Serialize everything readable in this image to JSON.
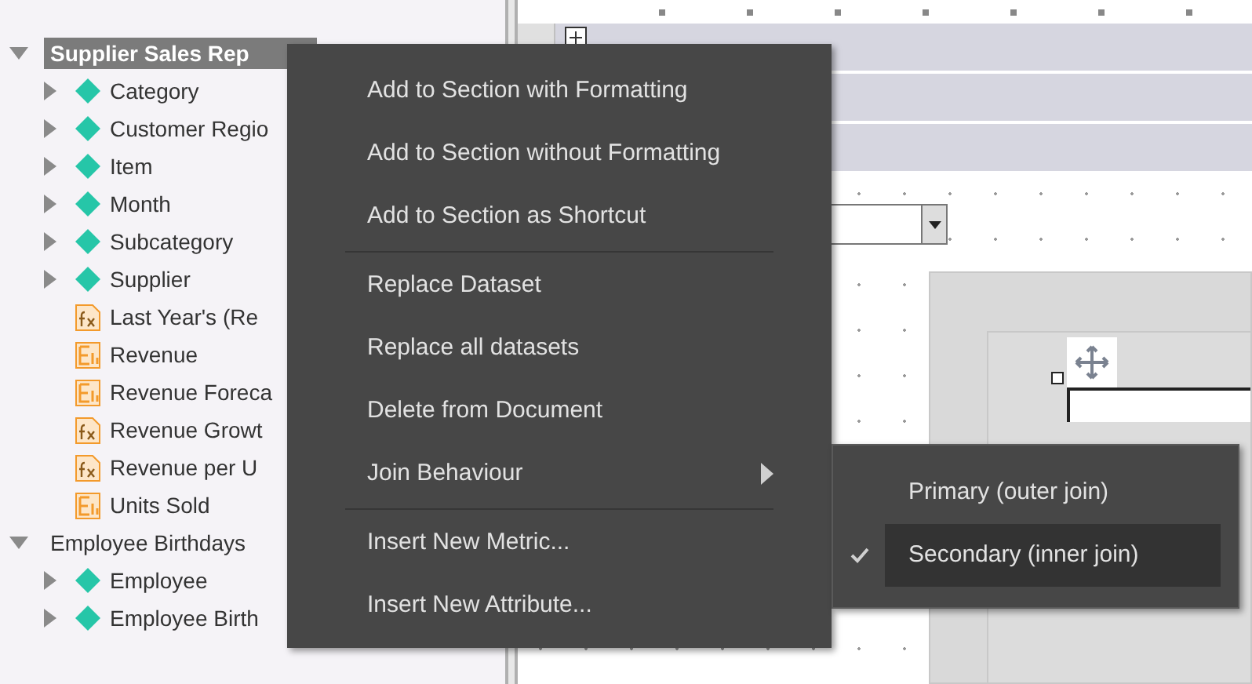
{
  "tree": [
    {
      "label": "Supplier Sales Rep",
      "selected": true,
      "expanded": true,
      "children": [
        {
          "label": "Category",
          "kind": "attribute",
          "expanded": false
        },
        {
          "label": "Customer Regio",
          "kind": "attribute",
          "expanded": false
        },
        {
          "label": "Item",
          "kind": "attribute",
          "expanded": false
        },
        {
          "label": "Month",
          "kind": "attribute",
          "expanded": false
        },
        {
          "label": "Subcategory",
          "kind": "attribute",
          "expanded": false
        },
        {
          "label": "Supplier",
          "kind": "attribute",
          "expanded": false
        },
        {
          "label": "Last Year's (Re",
          "kind": "derived"
        },
        {
          "label": "Revenue",
          "kind": "metric"
        },
        {
          "label": "Revenue Foreca",
          "kind": "metric"
        },
        {
          "label": "Revenue Growt",
          "kind": "derived"
        },
        {
          "label": "Revenue per U",
          "kind": "derived"
        },
        {
          "label": "Units Sold",
          "kind": "metric"
        }
      ]
    },
    {
      "label": "Employee Birthdays",
      "selected": false,
      "expanded": true,
      "children": [
        {
          "label": "Employee",
          "kind": "attribute",
          "expanded": false
        },
        {
          "label": "Employee Birth",
          "kind": "attribute",
          "expanded": false
        }
      ]
    }
  ],
  "context_menu": {
    "groups": [
      [
        {
          "label": "Add to Section with Formatting",
          "submenu": false
        },
        {
          "label": "Add to Section without Formatting",
          "submenu": false
        },
        {
          "label": "Add to Section as Shortcut",
          "submenu": false
        }
      ],
      [
        {
          "label": "Replace Dataset",
          "submenu": false
        },
        {
          "label": "Replace all datasets",
          "submenu": false
        },
        {
          "label": "Delete from Document",
          "submenu": false
        },
        {
          "label": "Join Behaviour",
          "submenu": true
        }
      ],
      [
        {
          "label": "Insert New Metric...",
          "submenu": false
        },
        {
          "label": "Insert New Attribute...",
          "submenu": false
        }
      ]
    ]
  },
  "submenu": {
    "items": [
      {
        "label": "Primary (outer join)",
        "selected": false
      },
      {
        "label": "Secondary (inner join)",
        "selected": true
      }
    ]
  }
}
